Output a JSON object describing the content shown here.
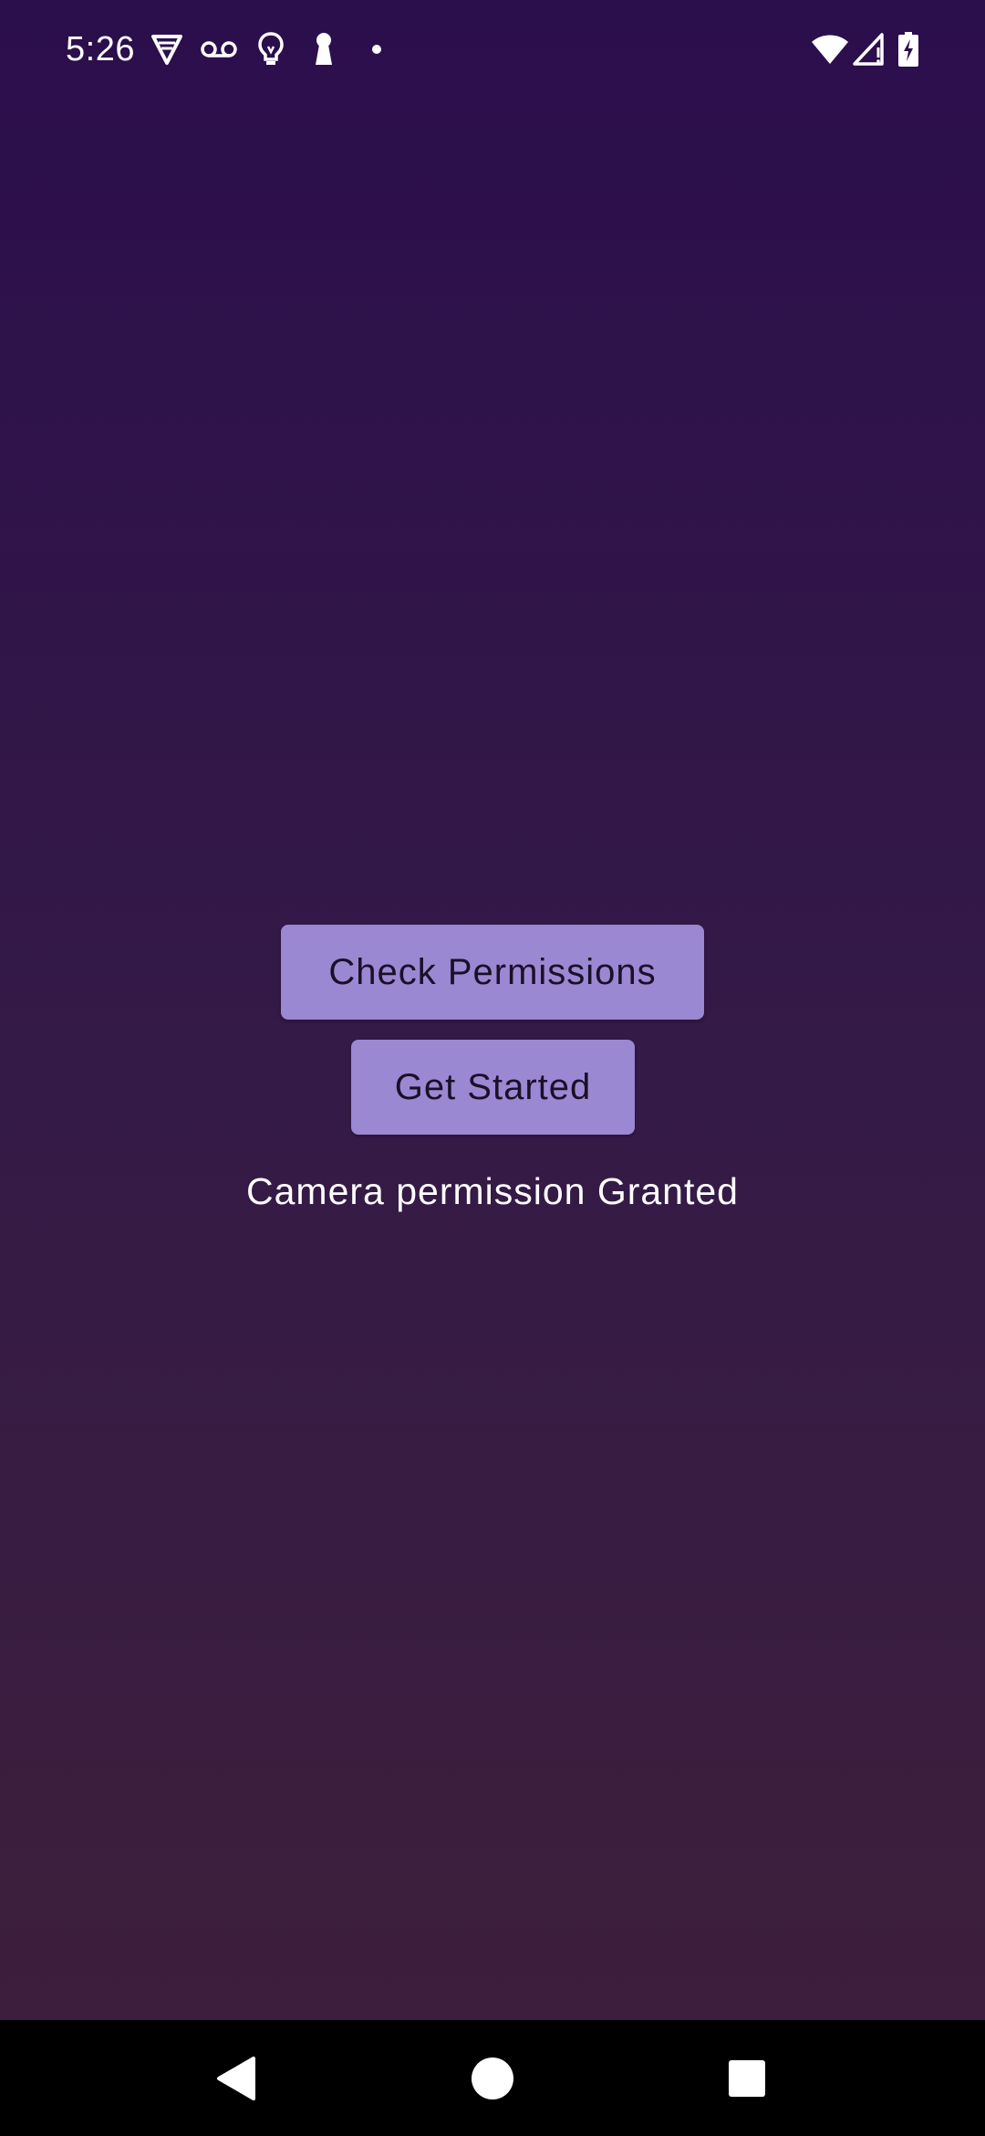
{
  "status_bar": {
    "time": "5:26",
    "left_icons": [
      "vpn-shield-icon",
      "voicemail-icon",
      "lightbulb-icon",
      "keyhole-icon",
      "notification-dot-icon"
    ],
    "right_icons": [
      "wifi-icon",
      "cell-signal-icon",
      "battery-charging-icon"
    ]
  },
  "main": {
    "check_permissions_label": "Check Permissions",
    "get_started_label": "Get Started",
    "permission_status_text": "Camera permission Granted"
  },
  "nav_bar": {
    "buttons": [
      "back-icon",
      "home-icon",
      "recents-icon"
    ]
  },
  "colors": {
    "background_top": "#2b0e4c",
    "background_bottom": "#3e1f3a",
    "button_fill": "#9b88d3",
    "button_text": "#1a1028",
    "text": "#ffffff",
    "nav_bar": "#000000"
  }
}
